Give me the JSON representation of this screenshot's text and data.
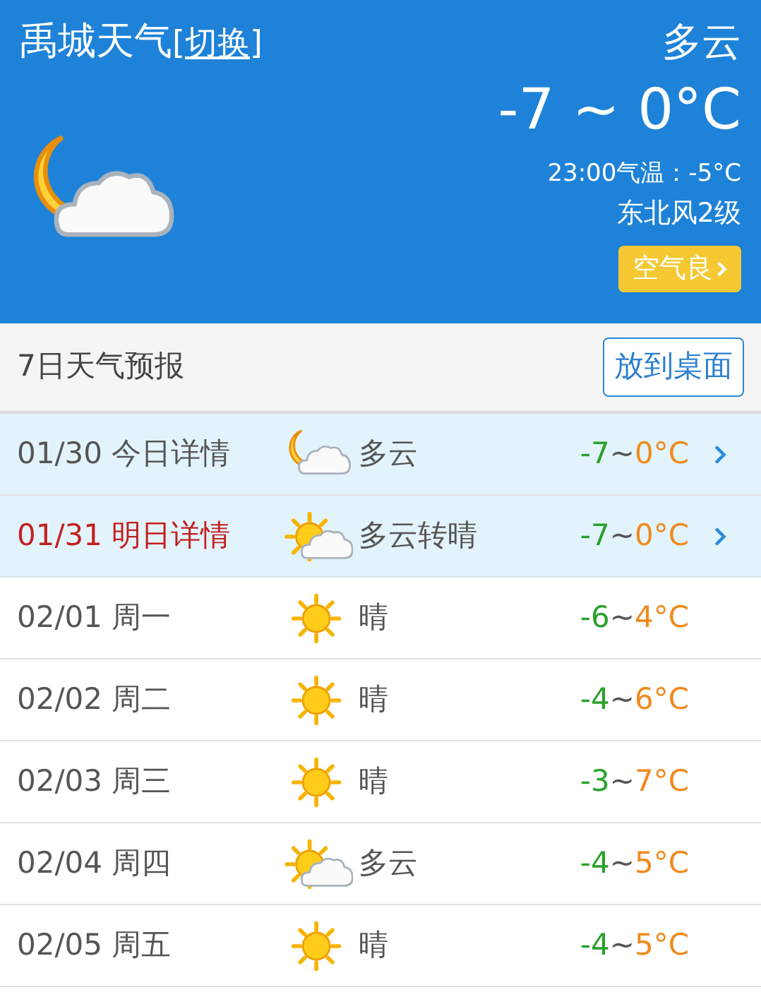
{
  "header": {
    "city_title": "禹城天气",
    "switch_link": "[切换]",
    "condition": "多云",
    "temperature": "-7 ~ 0°C",
    "current_temp": "23:00气温：-5°C",
    "wind": "东北风2级",
    "air_quality_button": "空气良",
    "kind": "moon-cloud"
  },
  "forecast": {
    "title": "7日天气预报",
    "desktop_button": "放到桌面",
    "days": [
      {
        "detail": true,
        "date": "01/30",
        "label": "今日详情",
        "emphasis": false,
        "kind": "moon-cloud",
        "condition": "多云",
        "low": "-7",
        "sep": "~",
        "high": "0°C"
      },
      {
        "detail": true,
        "date": "01/31",
        "label": "明日详情",
        "emphasis": true,
        "kind": "sun-cloud",
        "condition": "多云转晴",
        "low": "-7",
        "sep": "~",
        "high": "0°C"
      },
      {
        "detail": false,
        "date": "02/01",
        "label": "周一",
        "emphasis": false,
        "kind": "sun",
        "condition": "晴",
        "low": "-6",
        "sep": "~",
        "high": "4°C"
      },
      {
        "detail": false,
        "date": "02/02",
        "label": "周二",
        "emphasis": false,
        "kind": "sun",
        "condition": "晴",
        "low": "-4",
        "sep": "~",
        "high": "6°C"
      },
      {
        "detail": false,
        "date": "02/03",
        "label": "周三",
        "emphasis": false,
        "kind": "sun",
        "condition": "晴",
        "low": "-3",
        "sep": "~",
        "high": "7°C"
      },
      {
        "detail": false,
        "date": "02/04",
        "label": "周四",
        "emphasis": false,
        "kind": "sun-cloud",
        "condition": "多云",
        "low": "-4",
        "sep": "~",
        "high": "5°C"
      },
      {
        "detail": false,
        "date": "02/05",
        "label": "周五",
        "emphasis": false,
        "kind": "sun",
        "condition": "晴",
        "low": "-4",
        "sep": "~",
        "high": "5°C"
      }
    ]
  }
}
